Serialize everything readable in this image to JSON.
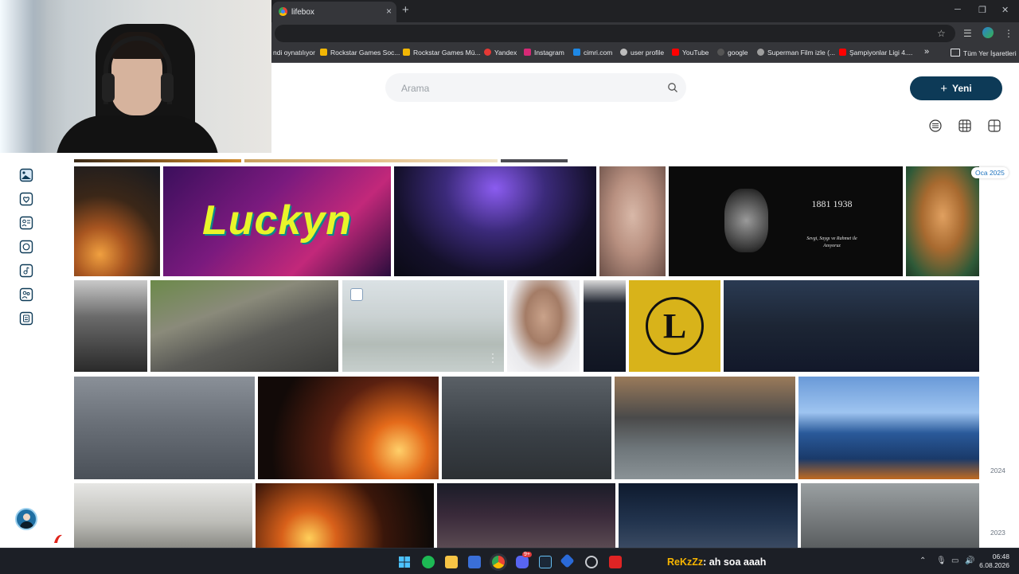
{
  "browser": {
    "tab_title": "lifebox",
    "tab_close": "×",
    "new_tab": "+",
    "window_controls": [
      "─",
      "❐",
      "✕"
    ],
    "bookmarks": [
      {
        "label": "ndi oynatılıyor",
        "icon": "none",
        "color": ""
      },
      {
        "label": "Rockstar Games Soc...",
        "icon": "rockstar-icon",
        "color": "#f2b705"
      },
      {
        "label": "Rockstar Games Mü...",
        "icon": "rockstar-icon",
        "color": "#f2b705"
      },
      {
        "label": "Yandex",
        "icon": "yandex-icon",
        "color": "#e53935"
      },
      {
        "label": "Instagram",
        "icon": "instagram-icon",
        "color": "#d62976"
      },
      {
        "label": "cimri.com",
        "icon": "cimri-icon",
        "color": "#1e88e5"
      },
      {
        "label": "user profile",
        "icon": "globe-icon",
        "color": "#bdbdbd"
      },
      {
        "label": "YouTube",
        "icon": "youtube-icon",
        "color": "#ff0000"
      },
      {
        "label": "google",
        "icon": "globe-icon",
        "color": "#555555"
      },
      {
        "label": "Superman Film izle (...",
        "icon": "film-icon",
        "color": "#9e9e9e"
      },
      {
        "label": "Şampiyonlar Ligi 4....",
        "icon": "youtube-icon",
        "color": "#ff0000"
      }
    ],
    "bookmarks_more": "»",
    "all_bookmarks": "Tüm Yer İşaretleri"
  },
  "app": {
    "search_placeholder": "Arama",
    "new_button_label": "Yeni",
    "new_button_icon": "+",
    "view_modes": [
      "list-view-icon",
      "grid-view-icon",
      "large-grid-view-icon"
    ],
    "nav_icons": [
      "photos-icon",
      "favorites-icon",
      "contacts-icon",
      "messages-icon",
      "music-icon",
      "people-icon",
      "documents-icon"
    ],
    "accent_color": "#0d3a57",
    "timeline": {
      "current": "Oca 2025",
      "years": [
        "2024",
        "2023"
      ]
    },
    "photo_text": {
      "lucky_logo": "Luckyn",
      "ataturk_years": "1881 1938",
      "ataturk_line1": "Sevgi, Saygı ve Rahmet ile",
      "ataturk_line2": "Anıyoruz",
      "emblem_letter": "L"
    }
  },
  "taskbar": {
    "chat_user": "ReKzZz",
    "chat_message": ": ah soa aaah",
    "time": "06:48",
    "date": "6.08.2026",
    "discord_badge": "9+"
  }
}
